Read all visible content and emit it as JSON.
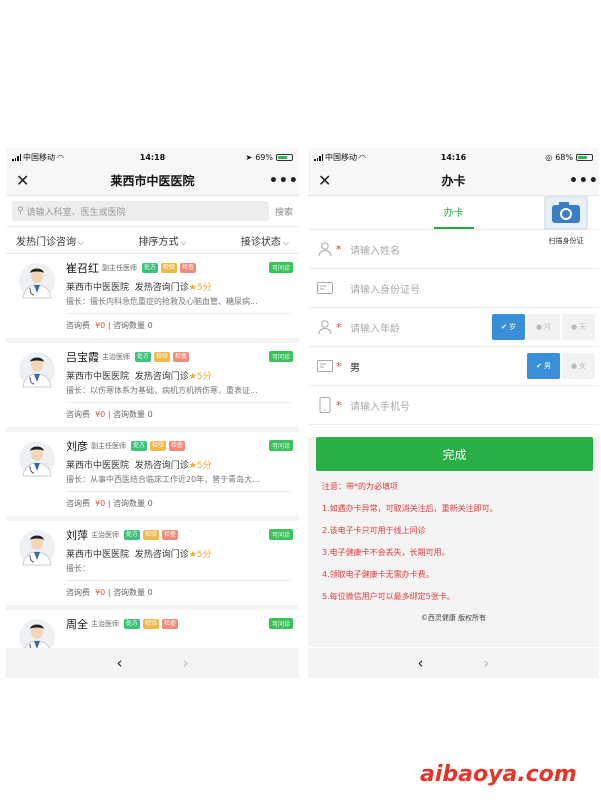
{
  "left": {
    "status": {
      "carrier": "中国移动",
      "time": "14:18",
      "battery": "69%",
      "battery_level": 0.69
    },
    "nav": {
      "title": "莱西市中医医院"
    },
    "search": {
      "placeholder": "请输入科室、医生或医院",
      "button": "搜索"
    },
    "filters": [
      "发热门诊咨询",
      "排序方式",
      "接诊状态"
    ],
    "tags": [
      "处方",
      "检验",
      "检查"
    ],
    "online_label": "可问诊",
    "fee_label": "咨询费",
    "count_label": "咨询数量",
    "doctors": [
      {
        "name": "崔召红",
        "title": "副主任医师",
        "hospital": "莱西市中医医院",
        "service": "发热咨询门诊",
        "rating": "5分",
        "skill": "擅长：擅长内科急危重症的抢救及心脑血管、糖尿病...",
        "fee": "¥0",
        "count": "0"
      },
      {
        "name": "吕宝霞",
        "title": "主治医师",
        "hospital": "莱西市中医医院",
        "service": "发热咨询门诊",
        "rating": "5分",
        "skill": "擅长：以伤寒体系为基础，病机方机辨伤寒，重表证...",
        "fee": "¥0",
        "count": "0"
      },
      {
        "name": "刘彦",
        "title": "副主任医师",
        "hospital": "莱西市中医医院",
        "service": "发热咨询门诊",
        "rating": "5分",
        "skill": "擅长：从事中西医结合临床工作近20年，曾于青岛大...",
        "fee": "¥0",
        "count": "0"
      },
      {
        "name": "刘萍",
        "title": "主治医师",
        "hospital": "莱西市中医医院",
        "service": "发热咨询门诊",
        "rating": "5分",
        "skill": "擅长：",
        "fee": "¥0",
        "count": "0"
      },
      {
        "name": "周全",
        "title": "主治医师",
        "hospital": "",
        "service": "",
        "rating": "",
        "skill": "",
        "fee": "",
        "count": ""
      }
    ],
    "pager": {
      "prev": "‹",
      "next": "›"
    }
  },
  "right": {
    "status": {
      "carrier": "中国移动",
      "time": "14:16",
      "battery": "68%",
      "battery_level": 0.68
    },
    "nav": {
      "title": "办卡"
    },
    "tab": "办卡",
    "form": {
      "name_placeholder": "请输入姓名",
      "id_placeholder": "请输入身份证号",
      "scan_label": "扫描身份证",
      "age_placeholder": "请输入年龄",
      "age_units": [
        "岁",
        "月",
        "天"
      ],
      "gender_value": "男",
      "gender_options": [
        "男",
        "女"
      ],
      "phone_placeholder": "请输入手机号",
      "submit": "完成"
    },
    "notes_head": "注意：带*的为必填项",
    "notes": [
      "1.如遇办卡异常，可取消关注后，重新关注即可。",
      "2.该电子卡只可用于线上问诊",
      "3.电子健康卡不会丢失，长期可用。",
      "4.领取电子健康卡无需办卡费。",
      "5.每位微信用户可以最多绑定5张卡。"
    ],
    "copyright": "©西灵健康 版权所有",
    "pager": {
      "prev": "‹",
      "next": "›"
    }
  },
  "watermark": "aibaoya.com",
  "colors": {
    "green": "#27ae45",
    "red": "#e03c3c",
    "blue": "#3a8fd8",
    "orange": "#f5a623"
  }
}
